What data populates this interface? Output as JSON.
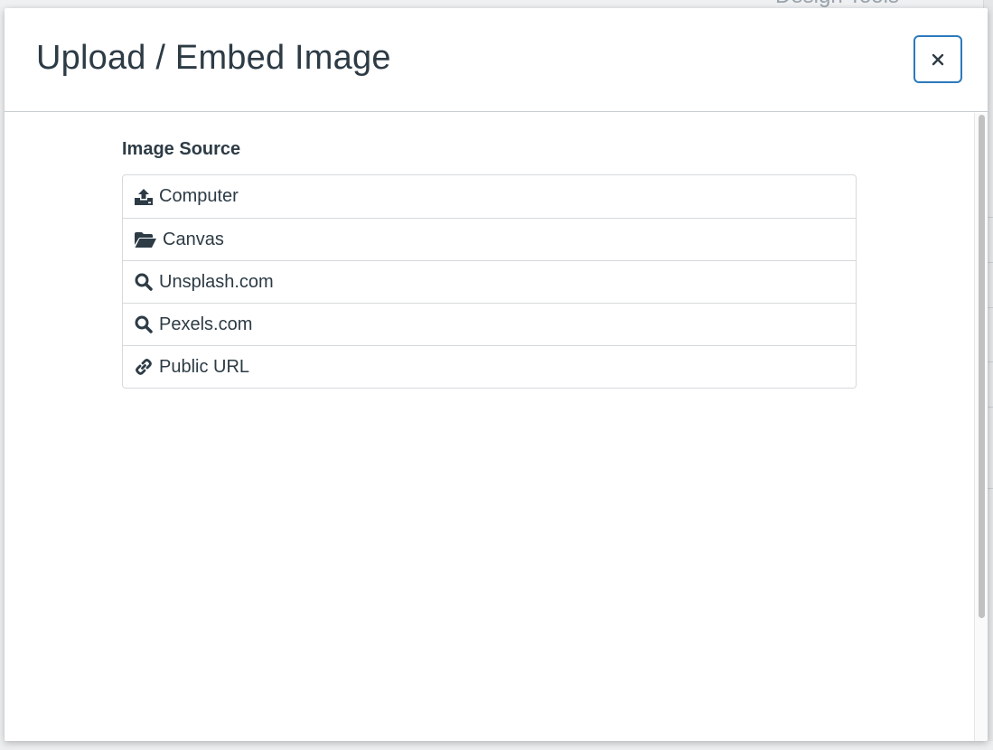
{
  "modal": {
    "title": "Upload / Embed Image",
    "close_label": "×"
  },
  "image_source": {
    "heading": "Image Source",
    "items": [
      {
        "label": "Computer",
        "icon": "upload-icon"
      },
      {
        "label": "Canvas",
        "icon": "folder-open-icon"
      },
      {
        "label": "Unsplash.com",
        "icon": "search-icon"
      },
      {
        "label": "Pexels.com",
        "icon": "search-icon"
      },
      {
        "label": "Public URL",
        "icon": "link-icon"
      }
    ]
  },
  "background": {
    "design_tools_label": "Design Tools"
  },
  "colors": {
    "accent": "#2b7abc",
    "text": "#2d3b45",
    "border": "#d6d9dc"
  }
}
